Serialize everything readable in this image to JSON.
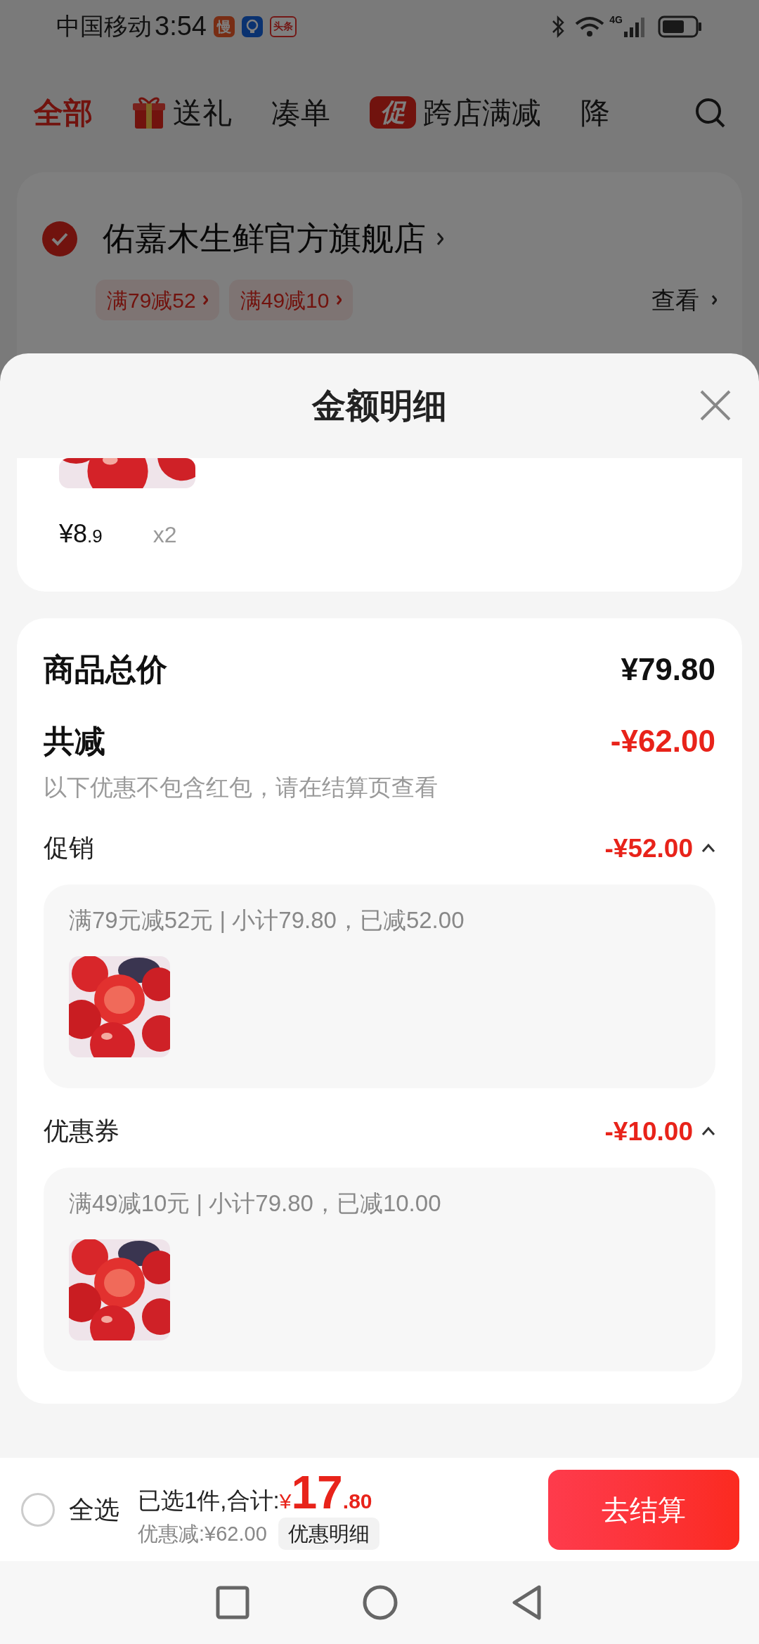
{
  "status_bar": {
    "carrier": "中国移动",
    "time": "3:54",
    "network": "4G",
    "notifications": [
      {
        "kind": "text",
        "label": "慢"
      },
      {
        "kind": "bulb"
      },
      {
        "kind": "news",
        "label": "头条"
      }
    ]
  },
  "tabs": [
    {
      "kind": "plain",
      "label": "全部",
      "selected": true
    },
    {
      "kind": "gift",
      "label": "送礼",
      "selected": false
    },
    {
      "kind": "plain",
      "label": "凑单",
      "selected": false
    },
    {
      "kind": "promo",
      "badge": "促",
      "label": "跨店满减",
      "selected": false
    },
    {
      "kind": "plain",
      "label": "降",
      "selected": false
    }
  ],
  "shop": {
    "checked": true,
    "name": "佑嘉木生鲜官方旗舰店",
    "tags": [
      "满79减52",
      "满49减10"
    ],
    "view": "查看"
  },
  "sheet": {
    "title": "金额明细",
    "item": {
      "price_main": "¥8",
      "price_decimal": ".9",
      "quantity": "x2"
    },
    "total_label": "商品总价",
    "total": "¥79.80",
    "discount_label": "共减",
    "discount": "-¥62.00",
    "note": "以下优惠不包含红包，请在结算页查看",
    "sections": [
      {
        "title": "促销",
        "amount": "-¥52.00",
        "expanded": true,
        "detail": "满79元减52元 | 小计79.80，已减52.00"
      },
      {
        "title": "优惠券",
        "amount": "-¥10.00",
        "expanded": true,
        "detail": "满49减10元 | 小计79.80，已减10.00"
      }
    ]
  },
  "bottom_bar": {
    "select_all": {
      "label": "全选",
      "checked": false
    },
    "selected_text": "已选1件,合计:",
    "currency": "¥",
    "total_main": "17",
    "total_decimal": ".80",
    "saved": "优惠减:¥62.00",
    "details_button": "优惠明细",
    "checkout": "去结算"
  }
}
